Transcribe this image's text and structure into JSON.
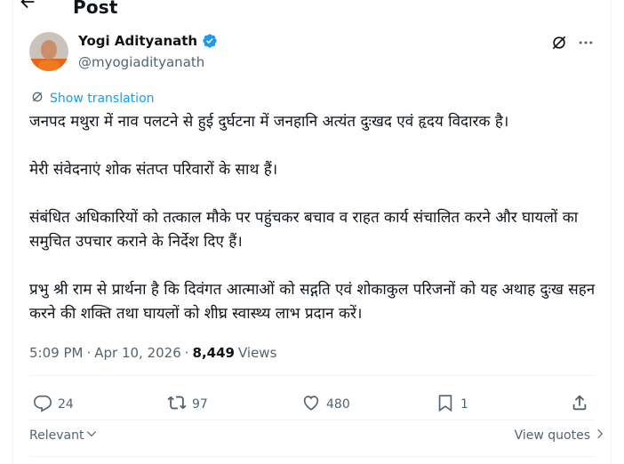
{
  "header": {
    "title": "Post",
    "back_icon": "arrow-left-icon"
  },
  "author": {
    "display_name": "Yogi Adityanath",
    "handle": "@myogiadityanath",
    "verified": true,
    "verified_color": "#1d9bf0"
  },
  "translate_label": "Show translation",
  "tweet": {
    "paragraphs": [
      "जनपद मथुरा में नाव पलटने से हुई दुर्घटना में जनहानि अत्यंत दुःखद एवं हृदय विदारक है।",
      "मेरी संवेदनाएं शोक संतप्त परिवारों के साथ हैं।",
      "संबंधित अधिकारियों को तत्काल मौके पर पहुंचकर बचाव व राहत कार्य संचालित करने और घायलों का समुचित उपचार कराने के निर्देश दिए हैं।",
      "प्रभु श्री राम से प्रार्थना है कि दिवंगत आत्माओं को सद्गति एवं शोकाकुल परिजनों को यह अथाह दुःख सहन करने की शक्ति तथा घायलों को शीघ्र स्वास्थ्य लाभ प्रदान करें।"
    ]
  },
  "meta": {
    "time": "5:09 PM",
    "separator": "·",
    "date": "Apr 10, 2026",
    "views_count": "8,449",
    "views_label": "Views"
  },
  "actions": {
    "replies": "24",
    "reposts": "97",
    "likes": "480",
    "bookmarks": "1"
  },
  "footer": {
    "sort_label": "Relevant",
    "view_quotes_label": "View quotes"
  },
  "colors": {
    "accent": "#1d9bf0",
    "text_primary": "#0f1419",
    "text_secondary": "#536471",
    "border": "#eff3f4"
  }
}
